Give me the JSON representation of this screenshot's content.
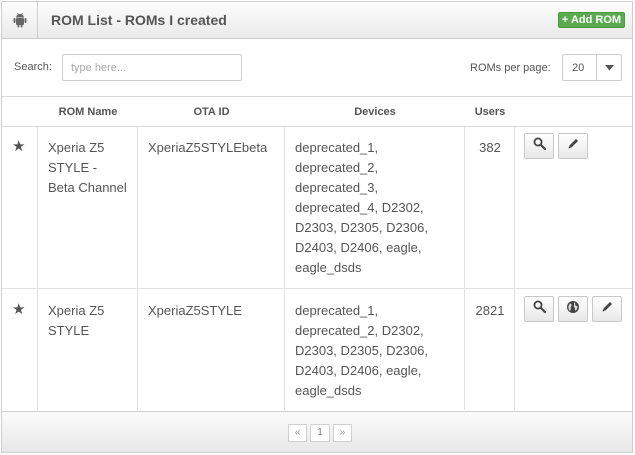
{
  "header": {
    "title": "ROM List - ROMs I created",
    "add_button": "+ Add ROM",
    "icon": "android-icon"
  },
  "toolbar": {
    "search_label": "Search:",
    "search_placeholder": "type here...",
    "search_value": "",
    "perpage_label": "ROMs per page:",
    "perpage_value": "20"
  },
  "table": {
    "columns": [
      "ROM Name",
      "OTA ID",
      "Devices",
      "Users"
    ],
    "rows": [
      {
        "name_lines": [
          "Xperia Z5",
          "STYLE -",
          "Beta Channel"
        ],
        "ota_id": "XperiaZ5STYLEbeta",
        "devices_lines": [
          "deprecated_1,",
          "deprecated_2,",
          "deprecated_3,",
          "deprecated_4, D2302,",
          "D2303, D2305, D2306,",
          "D2403, D2406, eagle,",
          "eagle_dsds"
        ],
        "users": "382",
        "actions": [
          "search-icon",
          "pencil-icon"
        ]
      },
      {
        "name_lines": [
          "Xperia Z5",
          "STYLE"
        ],
        "ota_id": "XperiaZ5STYLE",
        "devices_lines": [
          "deprecated_1,",
          "deprecated_2, D2302,",
          "D2303, D2305, D2306,",
          "D2403, D2406, eagle,",
          "eagle_dsds"
        ],
        "users": "2821",
        "actions": [
          "search-icon",
          "globe-icon",
          "pencil-icon"
        ]
      }
    ]
  },
  "pagination": {
    "prev": "«",
    "current": "1",
    "next": "»"
  },
  "colors": {
    "accent_green": "#5aab4f"
  }
}
